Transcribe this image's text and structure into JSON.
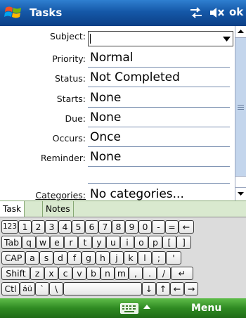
{
  "titlebar": {
    "title": "Tasks",
    "ok_label": "ok",
    "icons": [
      "windows-start-icon",
      "connectivity-icon",
      "volume-muted-icon"
    ]
  },
  "form": {
    "subject": {
      "label": "Subject:",
      "value": ""
    },
    "priority": {
      "label": "Priority:",
      "value": "Normal"
    },
    "status": {
      "label": "Status:",
      "value": "Not Completed"
    },
    "starts": {
      "label": "Starts:",
      "value": "None"
    },
    "due": {
      "label": "Due:",
      "value": "None"
    },
    "occurs": {
      "label": "Occurs:",
      "value": "Once"
    },
    "reminder": {
      "label": "Reminder:",
      "value": "None"
    },
    "categories": {
      "label": "Categories:",
      "value": "No categories..."
    }
  },
  "tabs": [
    {
      "label": "Task",
      "active": true
    },
    {
      "label": "Notes",
      "active": false
    }
  ],
  "keyboard": {
    "row1": [
      "123",
      "1",
      "2",
      "3",
      "4",
      "5",
      "6",
      "7",
      "8",
      "9",
      "0",
      "-",
      "=",
      "←"
    ],
    "row2": [
      "Tab",
      "q",
      "w",
      "e",
      "r",
      "t",
      "y",
      "u",
      "i",
      "o",
      "p",
      "[",
      "]"
    ],
    "row3": [
      "CAP",
      "a",
      "s",
      "d",
      "f",
      "g",
      "h",
      "j",
      "k",
      "l",
      ";",
      "'"
    ],
    "row4": [
      "Shift",
      "z",
      "x",
      "c",
      "v",
      "b",
      "n",
      "m",
      ",",
      ".",
      "/",
      "↵"
    ],
    "row5": [
      "Ctl",
      "áü",
      "`",
      "\\",
      "",
      "↓",
      "↑",
      "←",
      "→"
    ]
  },
  "menubar": {
    "menu_label": "Menu",
    "icons": [
      "keyboard-icon",
      "arrow-up-icon"
    ]
  },
  "colors": {
    "title_bar": "#1558a8",
    "menu_bar": "#2f8a22",
    "tab_strip": "#d9e9cf",
    "keyboard_bg": "#dcdcdc"
  }
}
